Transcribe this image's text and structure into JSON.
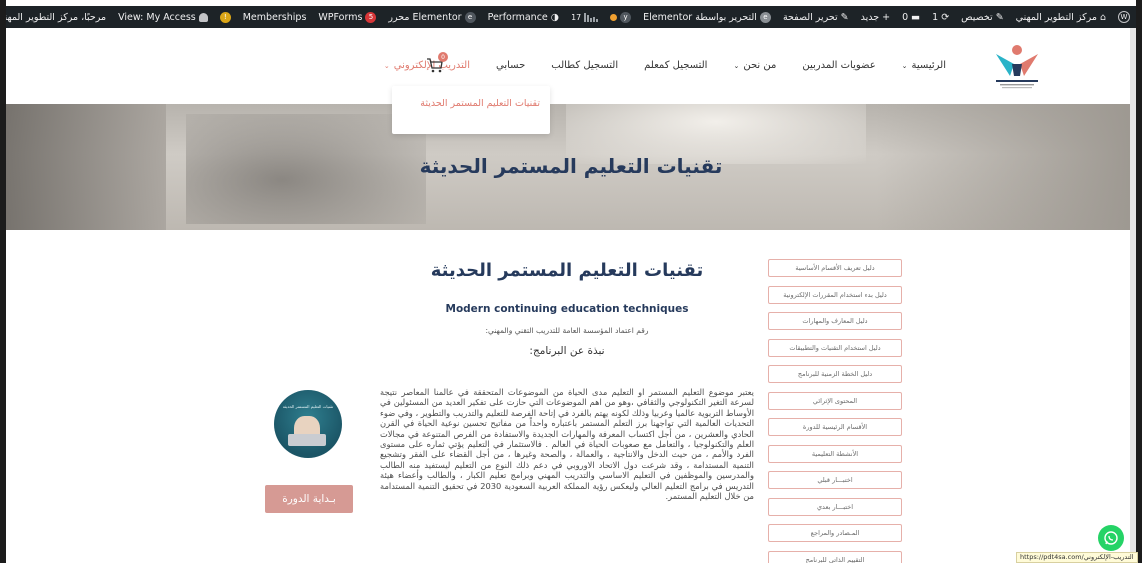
{
  "adminbar": {
    "site_name": "مركز التطوير المهني",
    "customize": "تخصيص",
    "updates_count": "1",
    "comments_count": "0",
    "new": "جديد",
    "edit_page": "تحرير الصفحة",
    "edit_with_elementor": "التحرير بواسطة Elementor",
    "notifications_count": "17",
    "performance": "Performance",
    "elementor_editor": "Elementor محرر",
    "wpforms": "WPForms",
    "wpforms_count": "5",
    "memberships": "Memberships",
    "notices_count": "!",
    "view_access": "View: My Access",
    "howdy": "مرحبًا، مركز التطوير المهني للتدريب"
  },
  "nav": {
    "items": [
      {
        "label": "الرئيسية",
        "has_dropdown": true
      },
      {
        "label": "عضويات المدربين",
        "has_dropdown": false
      },
      {
        "label": "من نحن",
        "has_dropdown": true
      },
      {
        "label": "التسجيل كمعلم",
        "has_dropdown": false
      },
      {
        "label": "التسجيل كطالب",
        "has_dropdown": false
      },
      {
        "label": "حسابي",
        "has_dropdown": false
      },
      {
        "label": "التدريب الإلكتروني",
        "has_dropdown": true,
        "active": true
      }
    ],
    "cart_count": "0",
    "dropdown_item": "تقنيات التعليم المستمر الحديثة"
  },
  "hero": {
    "title": "تقنيات التعليم المستمر الحديثة"
  },
  "sidebar": {
    "items": [
      "دليل تعريف الأقسام الأساسية",
      "دليل بدء استخدام المقررات الإلكترونية",
      "دليل المعارف والمهارات",
      "دليل استخدام التقنيات والتطبيقات",
      "دليل الخطة الزمنية للبرنامج",
      "المحتوى الإثرائي",
      "الأقسام الرئيسية للدورة",
      "الأنشطة التعليمية",
      "اختبـــار قبلي",
      "اختبـــار بعدي",
      "المـصادر والمراجع",
      "التقييم الذاتي للبرنامج"
    ]
  },
  "main": {
    "title": "تقنيات التعليم المستمر الحديثة",
    "subtitle_en": "Modern continuing education techniques",
    "accreditation": "رقم اعتماد المؤسسة العامة للتدريب التقني والمهني:",
    "about_heading": "نبذة عن البرنامج:",
    "body": "يعتبر موضوع التعليم المستمر او التعليم مدى الحياة من الموضوعات المتحققة في عالمنا المعاصر نتيجة لسرعة التغير التكنولوجي والثقافي ،وهو من اهم الموضوعات التي حازت على تفكير العديد من المسئولين في الأوساط التربوية عالميا وعربيا وذلك لكونه يهتم بالفرد في إتاحة الفرصة للتعليم والتدريب والتطوير ، وفي ضوء التحديات العالمية التي تواجهنا برز التعلم المستمر باعتباره واحداً من مفاتيح تحسين نوعية الحياة في القرن الحادي والعشرين ، من أجل اكتساب المعرفة والمهارات الجديدة والاستفادة من الفرص المتنوعة في مجالات العلم والتكنولوجيا ، والتعامل مع صعوبات الحياة في العالم . فالاستثمار في التعليم يؤتي ثماره على مستوى الفرد والأمم ، من حيث الدخل والانتاجية ، والعمالة ، والصحة وغيرها ، من أجل القضاء على الفقر وتشجيع التنمية المستدامة ، وقد شرعت دول الاتحاد الاوروبي في دعم ذلك النوع من التعليم ليستفيد منه الطالب والمدرسين والموظفين في التعليم الاساسي والتدريب المهني وبرامج تعليم الكبار ، والطالب وأعضاء هيئة التدريس في برامج التعليم العالي وليعكس رؤية المملكة العربية السعودية 2030 في تحقيق التنمية المستدامة من خلال التعليم المستمر."
  },
  "course": {
    "image_caption": "تقنيات التعليم المستمر الحديثة",
    "start_button": "بـداية الدورة"
  },
  "status_url": "https://pdt4sa.com/التدريب-الإلكتروني",
  "colors": {
    "accent": "#e07a6e",
    "navy": "#263a5c",
    "button": "#d69a94",
    "adminbar": "#1d2327"
  }
}
